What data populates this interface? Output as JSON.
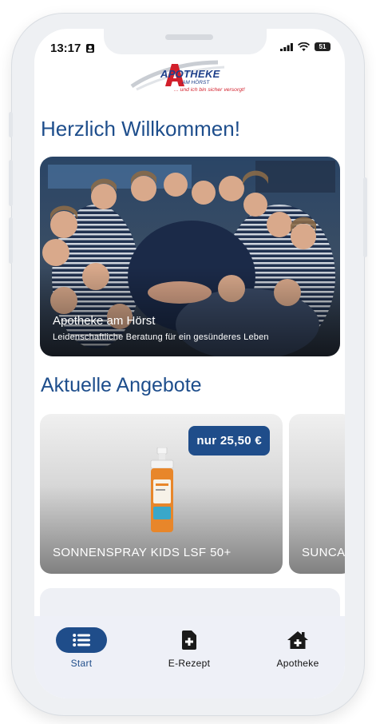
{
  "status_bar": {
    "time": "13:17",
    "battery": "51"
  },
  "logo": {
    "name": "APOTHEKE",
    "subtitle": "AM HÖRST",
    "slogan": "... und ich bin sicher versorgt!"
  },
  "welcome_title": "Herzlich Willkommen!",
  "hero": {
    "title": "Apotheke am Hörst",
    "subtitle": "Leidenschaftliche Beratung für ein gesünderes Leben"
  },
  "offers": {
    "title": "Aktuelle Angebote",
    "items": [
      {
        "price": "nur 25,50 €",
        "name": "SONNENSPRAY KIDS LSF 50+"
      },
      {
        "name": "SUNCA"
      }
    ]
  },
  "tabs": [
    {
      "label": "Start",
      "icon": "list-icon",
      "active": true
    },
    {
      "label": "E-Rezept",
      "icon": "prescription-icon",
      "active": false
    },
    {
      "label": "Apotheke",
      "icon": "pharmacy-house-icon",
      "active": false
    }
  ],
  "colors": {
    "brand_blue": "#1f4d8a",
    "title_blue": "#1e4e8c",
    "logo_red": "#d21f2b"
  }
}
